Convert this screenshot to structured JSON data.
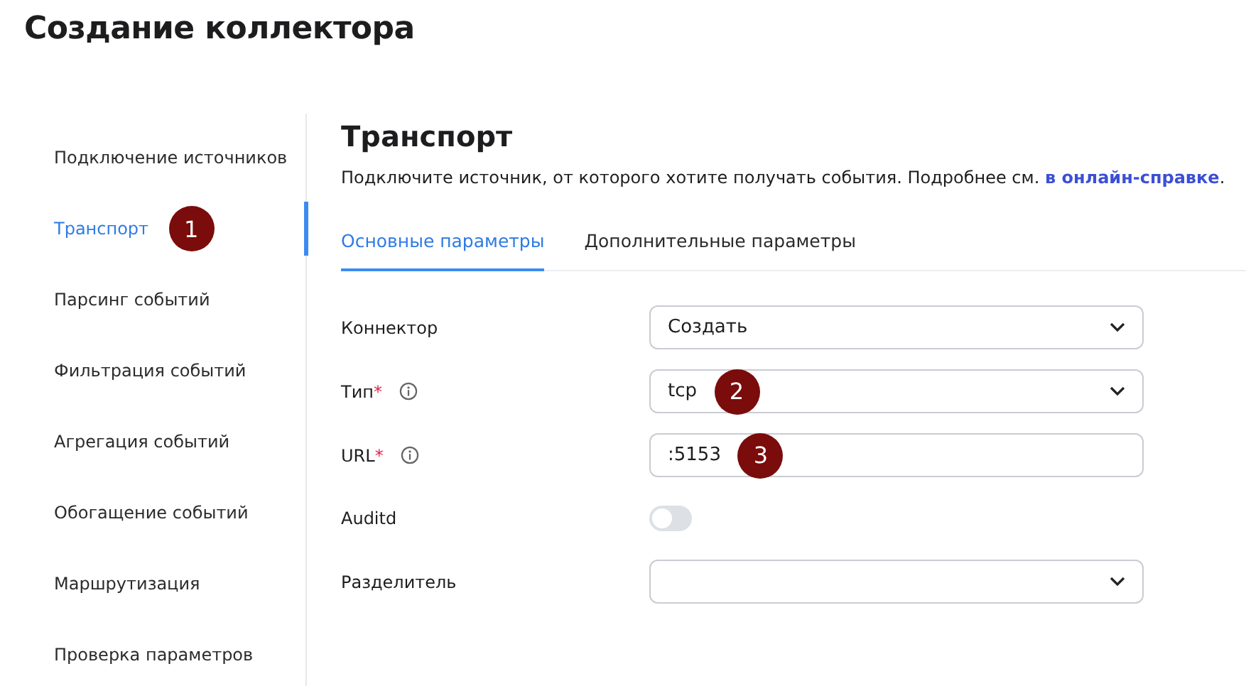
{
  "page_title": "Создание коллектора",
  "sidebar": {
    "items": [
      {
        "label": "Подключение источников",
        "selected": false
      },
      {
        "label": "Транспорт",
        "selected": true,
        "badge": "1"
      },
      {
        "label": "Парсинг событий",
        "selected": false
      },
      {
        "label": "Фильтрация событий",
        "selected": false
      },
      {
        "label": "Агрегация событий",
        "selected": false
      },
      {
        "label": "Обогащение событий",
        "selected": false
      },
      {
        "label": "Маршрутизация",
        "selected": false
      },
      {
        "label": "Проверка параметров",
        "selected": false
      }
    ]
  },
  "section": {
    "title": "Транспорт",
    "description": "Подключите источник, от которого хотите получать события. Подробнее см. ",
    "help_link": "в онлайн-справке",
    "description_end": "."
  },
  "tabs": [
    {
      "label": "Основные параметры",
      "selected": true
    },
    {
      "label": "Дополнительные параметры",
      "selected": false
    }
  ],
  "fields": [
    {
      "kind": "select",
      "label": "Коннектор",
      "value": "Создать"
    },
    {
      "kind": "select",
      "label": "Тип",
      "required_mark": "*",
      "info": true,
      "value": "tcp",
      "badge": "2"
    },
    {
      "kind": "input",
      "label": "URL",
      "required_mark": "*",
      "info": true,
      "value": ":5153",
      "badge": "3"
    },
    {
      "kind": "toggle",
      "label": "Auditd",
      "on": false
    },
    {
      "kind": "select",
      "label": "Разделитель"
    }
  ]
}
